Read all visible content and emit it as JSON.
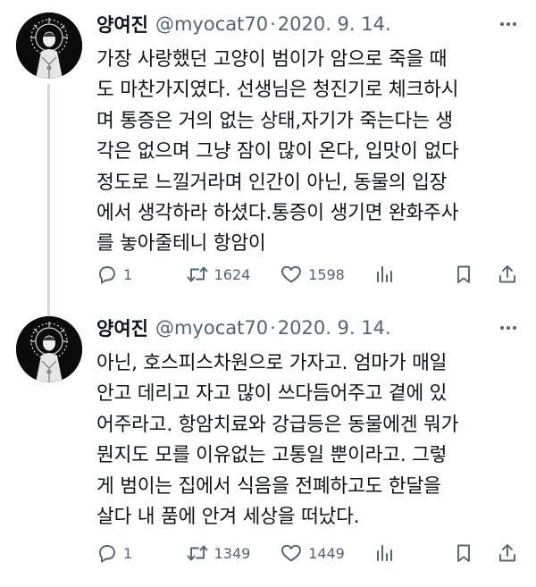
{
  "tweets": [
    {
      "author_name": "양여진",
      "handle": "@myocat70",
      "separator": "·",
      "date": "2020. 9. 14.",
      "text": "가장 사랑했던 고양이 범이가 암으로 죽을 때\n도 마찬가지였다. 선생님은 청진기로 체크하시\n며 통증은 거의 없는 상태,자기가 죽는다는 생\n각은 없으며 그냥 잠이 많이 온다, 입맛이 없다\n정도로 느낄거라며 인간이 아닌, 동물의 입장\n에서 생각하라 하셨다.통증이 생기면 완화주사\n를 놓아줄테니 항암이",
      "reply_count": "1",
      "retweet_count": "1624",
      "like_count": "1598"
    },
    {
      "author_name": "양여진",
      "handle": "@myocat70",
      "separator": "·",
      "date": "2020. 9. 14.",
      "text": "아닌, 호스피스차원으로 가자고. 엄마가 매일\n안고 데리고 자고 많이 쓰다듬어주고 곁에 있\n어주라고. 항암치료와 강급등은 동물에겐 뭐가\n뭔지도 모를 이유없는 고통일 뿐이라고. 그렇\n게 범이는 집에서 식음을 전폐하고도 한달을\n살다 내 품에 안겨 세상을 떠났다.",
      "reply_count": "1",
      "retweet_count": "1349",
      "like_count": "1449"
    }
  ],
  "icons": {
    "reply": "speech-bubble",
    "retweet": "retweet-arrows",
    "like": "heart",
    "views": "bar-chart",
    "bookmark": "bookmark",
    "share": "share-upload",
    "more": "three-dots"
  },
  "colors": {
    "text": "#0f1419",
    "secondary": "#536471",
    "thread_line": "#cfd9de",
    "background": "#ffffff"
  }
}
